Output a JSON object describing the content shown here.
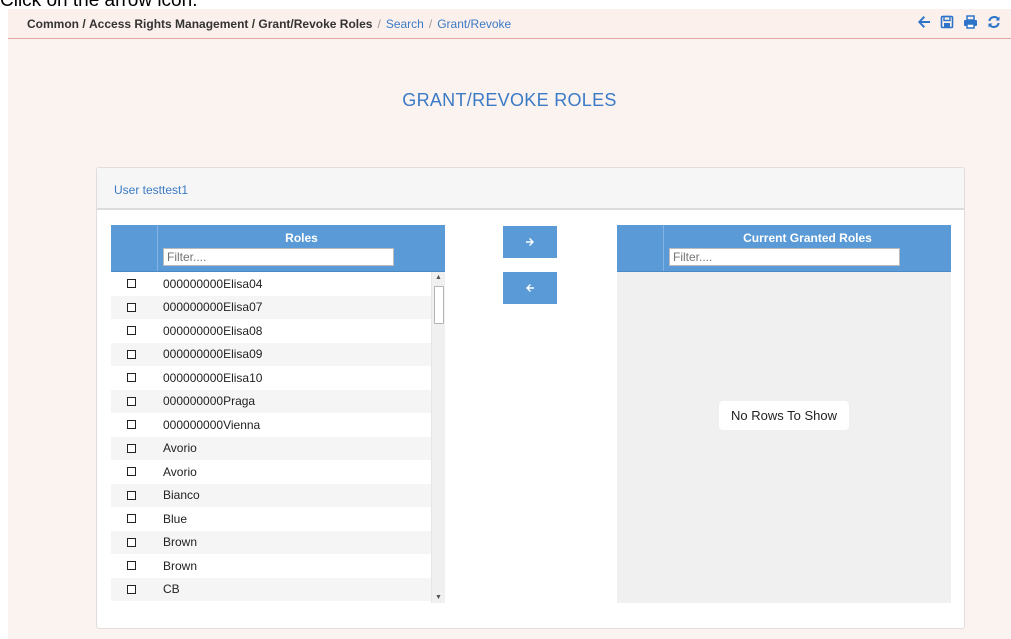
{
  "instruction": "Click on the arrow icon.",
  "breadcrumb": {
    "items": [
      "Common",
      "Access Rights Management",
      "Grant/Revoke Roles"
    ],
    "links": [
      "Search",
      "Grant/Revoke"
    ],
    "separator": "/"
  },
  "toolbar_icons": [
    "arrow-left-icon",
    "save-icon",
    "print-icon",
    "refresh-icon"
  ],
  "page_title": "GRANT/REVOKE ROLES",
  "panel_header": "User testtest1",
  "roles_grid": {
    "header": "Roles",
    "filter_placeholder": "Filter....",
    "rows": [
      "000000000Elisa04",
      "000000000Elisa07",
      "000000000Elisa08",
      "000000000Elisa09",
      "000000000Elisa10",
      "000000000Praga",
      "000000000Vienna",
      "Avorio",
      "Avorio",
      "Bianco",
      "Blue",
      "Brown",
      "Brown",
      "CB"
    ]
  },
  "move_buttons": {
    "right": "→",
    "left": "←"
  },
  "granted_grid": {
    "header": "Current Granted Roles",
    "filter_placeholder": "Filter....",
    "empty_text": "No Rows To Show"
  },
  "colors": {
    "accent": "#5a9ad6",
    "link": "#3b7ac6",
    "page_bg": "#fbf3ef"
  }
}
